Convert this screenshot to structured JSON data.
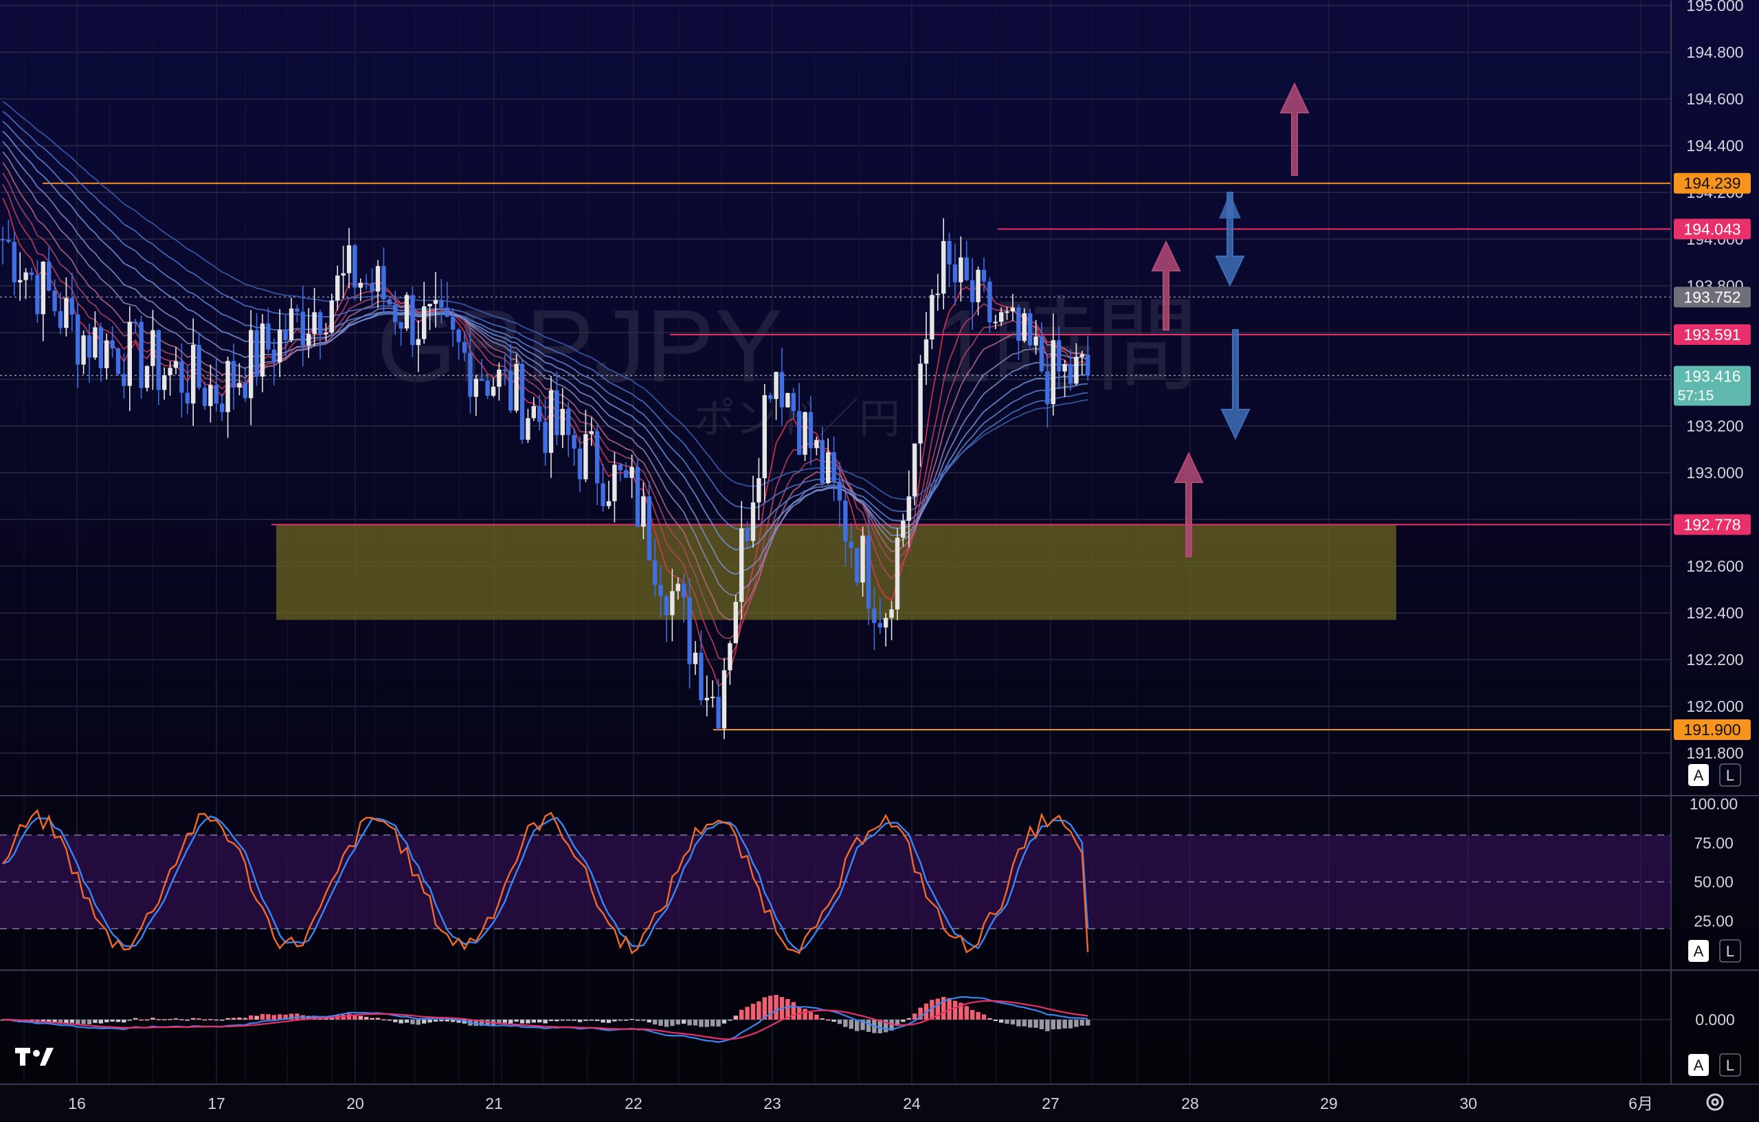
{
  "watermark": {
    "symbol": "GBPJPY",
    "interval": "1時間",
    "description": "ポンド／円"
  },
  "logo": "TradingView",
  "colors": {
    "background": "#060512",
    "orange_line": "#f7941d",
    "pink_line": "#e8306a",
    "support_zone": "#6b6420",
    "up_arrow": "#b24a76",
    "down_arrow": "#3d6db6",
    "candle_up": "#e6e6e6",
    "candle_down": "#3f6fe0",
    "current_price": "#5fb9ae",
    "stoch_k": "#f16a2a",
    "stoch_d": "#3a86f2",
    "macd_line": "#3a86f2",
    "signal_line": "#e8306a"
  },
  "price_axis": {
    "ticks": [
      "195.000",
      "194.800",
      "194.600",
      "194.400",
      "194.200",
      "194.000",
      "193.800",
      "193.200",
      "193.000",
      "192.600",
      "192.400",
      "192.200",
      "192.000",
      "191.800"
    ]
  },
  "price_labels": [
    {
      "text": "194.239",
      "kind": "orange"
    },
    {
      "text": "194.043",
      "kind": "pink"
    },
    {
      "text": "193.752",
      "kind": "gray"
    },
    {
      "text": "193.591",
      "kind": "pink"
    },
    {
      "text": "192.778",
      "kind": "pink"
    },
    {
      "text": "191.900",
      "kind": "orange"
    }
  ],
  "current_price": {
    "value": "193.416",
    "countdown": "57:15"
  },
  "stoch_axis": {
    "ticks": [
      "100.00",
      "75.00",
      "50.00",
      "25.00"
    ]
  },
  "macd_axis": {
    "ticks": [
      "0.000"
    ]
  },
  "time_axis": {
    "ticks": [
      "16",
      "17",
      "20",
      "21",
      "22",
      "23",
      "24",
      "27",
      "28",
      "29",
      "30",
      "6月"
    ]
  },
  "buttons": {
    "auto": "A",
    "log": "L"
  },
  "chart_data": {
    "type": "candlestick",
    "symbol": "GBPJPY",
    "interval": "1時間",
    "ylim": [
      191.7,
      195.0
    ],
    "horizontal_levels": [
      194.239,
      194.043,
      193.752,
      193.591,
      192.778,
      191.9
    ],
    "support_zone": [
      192.37,
      192.78
    ],
    "current_price": 193.416,
    "key_prices": [
      {
        "x": "16",
        "y": 193.6
      },
      {
        "x": "17",
        "y": 193.35
      },
      {
        "x": "20",
        "y": 193.85
      },
      {
        "x": "21",
        "y": 193.4
      },
      {
        "x": "22",
        "y": 192.9
      },
      {
        "x": "22.6",
        "y": 192.0
      },
      {
        "x": "23",
        "y": 193.5
      },
      {
        "x": "23.8",
        "y": 192.4
      },
      {
        "x": "24",
        "y": 193.0
      },
      {
        "x": "24.5",
        "y": 193.9
      },
      {
        "x": "27",
        "y": 193.416
      }
    ],
    "stochastic": {
      "levels": [
        80,
        50,
        20
      ],
      "last_k": 5,
      "last_d": 20
    },
    "macd": {
      "zero": 0.0
    }
  }
}
